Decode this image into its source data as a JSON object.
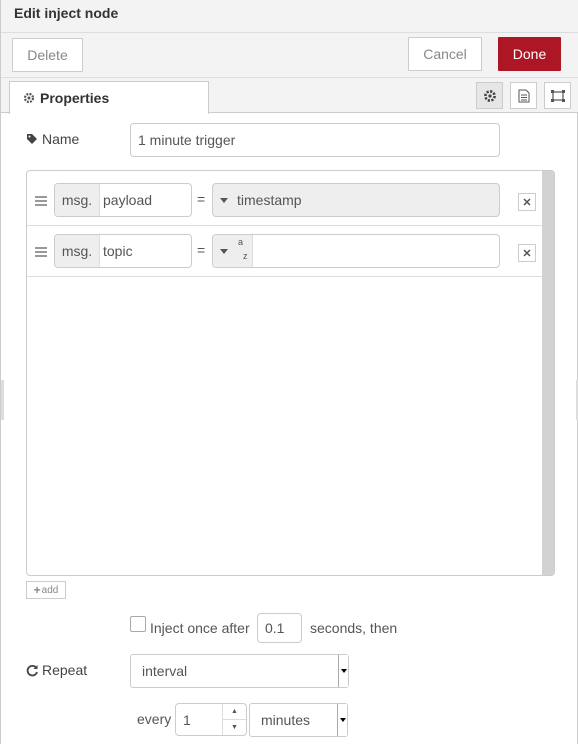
{
  "title": "Edit inject node",
  "buttons": {
    "delete": "Delete",
    "cancel": "Cancel",
    "done": "Done"
  },
  "tab": {
    "label": "Properties"
  },
  "name": {
    "label": "Name",
    "value": "1 minute trigger"
  },
  "properties": [
    {
      "prefix": "msg.",
      "key": "payload",
      "equals": "=",
      "value": "timestamp",
      "type_icon": "timestamp"
    },
    {
      "prefix": "msg.",
      "key": "topic",
      "equals": "=",
      "value": "",
      "type_icon": "string-az"
    }
  ],
  "add_button": "add",
  "inject_once": {
    "label": "Inject once after",
    "value": "0.1",
    "suffix": "seconds, then",
    "checked": false
  },
  "repeat": {
    "label": "Repeat",
    "selected": "interval"
  },
  "every": {
    "label": "every",
    "value": "1",
    "unit": "minutes"
  },
  "colors": {
    "done_button": "#ad1625",
    "header_bg": "#f3f3f3"
  }
}
